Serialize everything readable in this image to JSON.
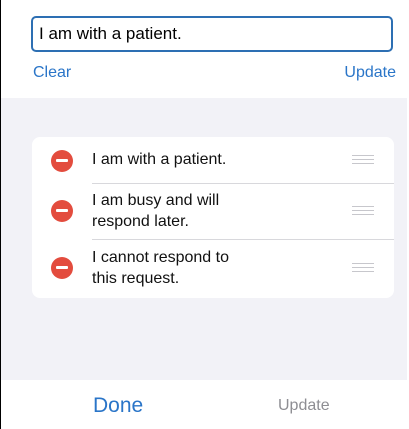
{
  "editor": {
    "input_value": "I am with a patient.",
    "clear_label": "Clear",
    "update_label": "Update"
  },
  "responses": {
    "items": [
      {
        "text": "I am with a patient."
      },
      {
        "text": "I am busy and will\nrespond later."
      },
      {
        "text": "I cannot respond to\nthis request."
      }
    ]
  },
  "footer": {
    "done_label": "Done",
    "update_label": "Update"
  },
  "colors": {
    "accent": "#2a75c8",
    "delete": "#e34c3e",
    "background": "#f2f2f7",
    "disabled": "#8e8e93"
  },
  "icons": [
    "delete-icon",
    "drag-handle-icon"
  ]
}
